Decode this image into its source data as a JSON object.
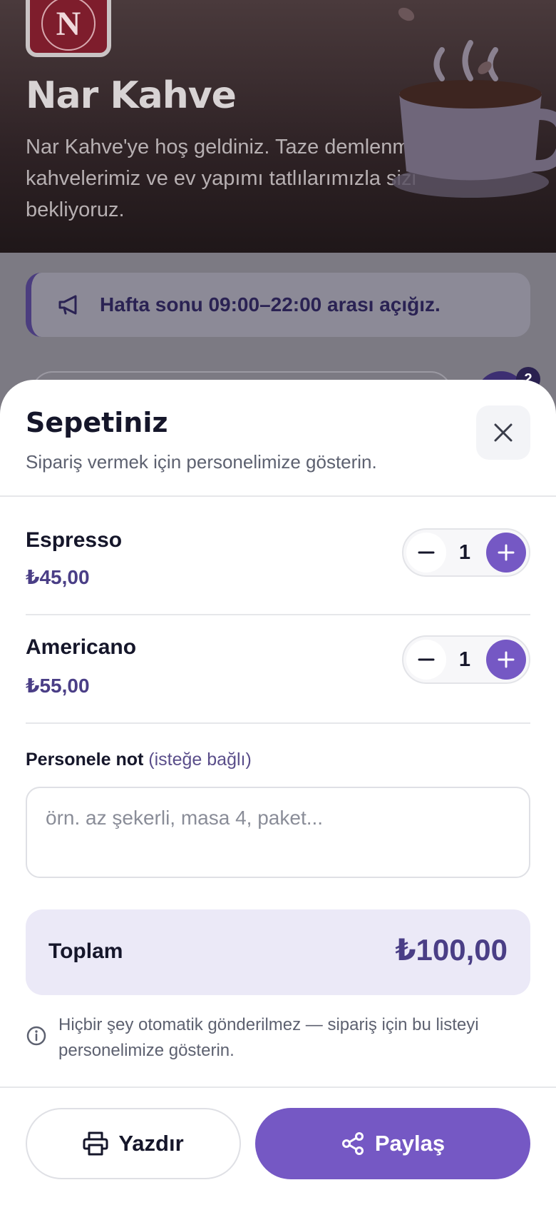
{
  "brand": {
    "logo_letter": "N",
    "name": "Nar Kahve",
    "description": "Nar Kahve'ye hoş geldiniz. Taze demlenmiş kahvelerimiz ve ev yapımı tatlılarımızla sizi bekliyoruz."
  },
  "notice": {
    "text": "Hafta sonu 09:00–22:00 arası açığız.",
    "icon": "megaphone-icon"
  },
  "cart_badge_count": "2",
  "cart": {
    "title": "Sepetiniz",
    "subtitle": "Sipariş vermek için personelimize gösterin.",
    "items": [
      {
        "name": "Espresso",
        "price": "₺45,00",
        "quantity": "1"
      },
      {
        "name": "Americano",
        "price": "₺55,00",
        "quantity": "1"
      }
    ],
    "note_label": "Personele not",
    "note_optional": "(isteğe bağlı)",
    "note_value": "",
    "note_placeholder": "örn. az şekerli, masa 4, paket...",
    "total_label": "Toplam",
    "total_value": "₺100,00",
    "info_text": "Hiçbir şey otomatik gönderilmez — sipariş için bu listeyi personelimize gösterin.",
    "print_label": "Yazdır",
    "share_label": "Paylaş"
  },
  "colors": {
    "accent": "#7558c4",
    "price": "#4a3e86",
    "total_bg": "#ebe9f7",
    "logo_bg": "#7e1d2c"
  }
}
